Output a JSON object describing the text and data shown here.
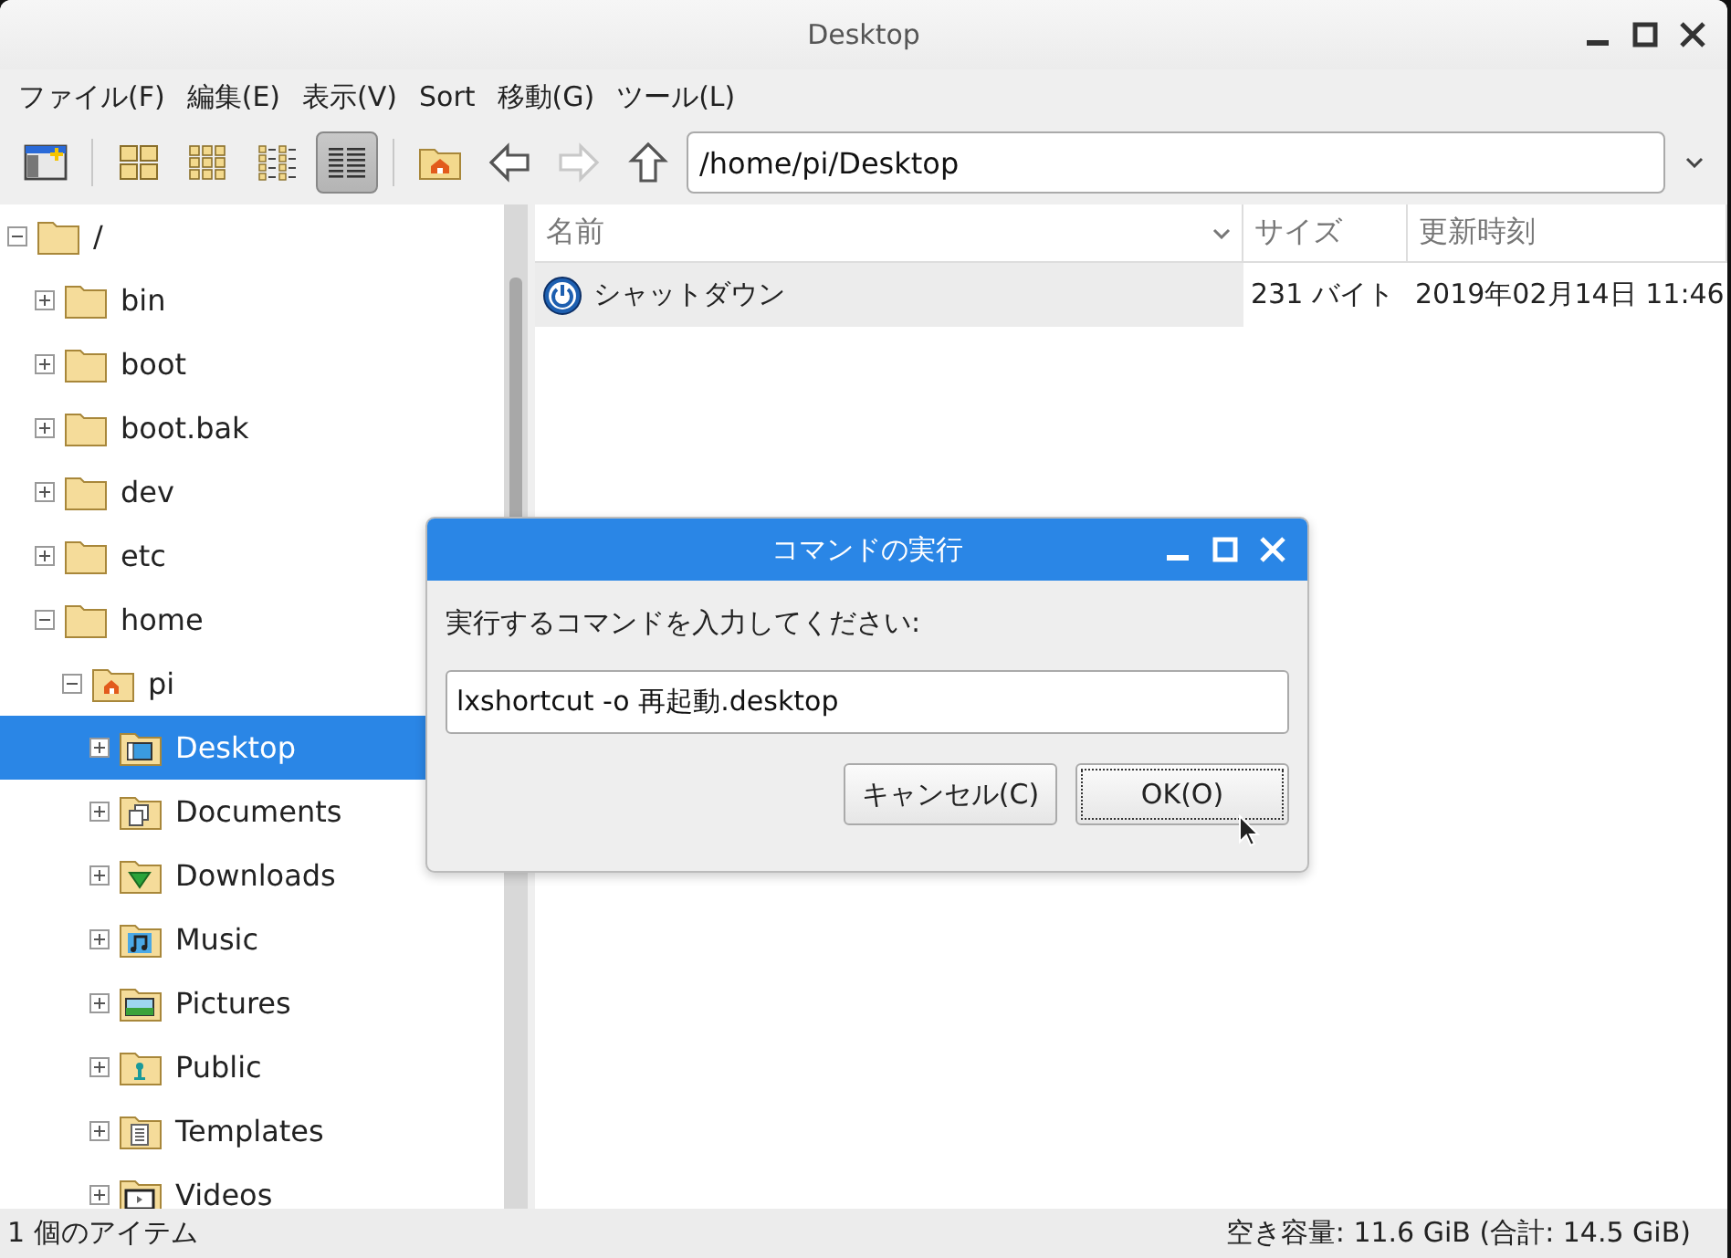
{
  "window": {
    "title": "Desktop"
  },
  "menu": [
    "ファイル(F)",
    "編集(E)",
    "表示(V)",
    "Sort",
    "移動(G)",
    "ツール(L)"
  ],
  "toolbar": {
    "view_modes": [
      {
        "kind": "icons",
        "selected": false
      },
      {
        "kind": "thumbnails",
        "selected": false
      },
      {
        "kind": "compact",
        "selected": false
      },
      {
        "kind": "list",
        "selected": true
      }
    ],
    "nav": [
      {
        "kind": "home",
        "disabled": false
      },
      {
        "kind": "back",
        "disabled": false
      },
      {
        "kind": "forward",
        "disabled": true
      },
      {
        "kind": "up",
        "disabled": false
      }
    ],
    "path": "/home/pi/Desktop"
  },
  "tree": [
    {
      "label": "/",
      "kind": "folder",
      "expanded": true,
      "selected": false,
      "children": [
        {
          "label": "bin",
          "kind": "folder",
          "expanded": false,
          "selected": false
        },
        {
          "label": "boot",
          "kind": "folder",
          "expanded": false,
          "selected": false
        },
        {
          "label": "boot.bak",
          "kind": "folder",
          "expanded": false,
          "selected": false
        },
        {
          "label": "dev",
          "kind": "folder",
          "expanded": false,
          "selected": false
        },
        {
          "label": "etc",
          "kind": "folder",
          "expanded": false,
          "selected": false
        },
        {
          "label": "home",
          "kind": "folder",
          "expanded": true,
          "selected": false,
          "children": [
            {
              "label": "pi",
              "kind": "home",
              "expanded": true,
              "selected": false,
              "children": [
                {
                  "label": "Desktop",
                  "kind": "desktop",
                  "expanded": false,
                  "selected": true
                },
                {
                  "label": "Documents",
                  "kind": "documents",
                  "expanded": false,
                  "selected": false
                },
                {
                  "label": "Downloads",
                  "kind": "downloads",
                  "expanded": false,
                  "selected": false
                },
                {
                  "label": "Music",
                  "kind": "music",
                  "expanded": false,
                  "selected": false
                },
                {
                  "label": "Pictures",
                  "kind": "pictures",
                  "expanded": false,
                  "selected": false
                },
                {
                  "label": "Public",
                  "kind": "public",
                  "expanded": false,
                  "selected": false
                },
                {
                  "label": "Templates",
                  "kind": "templates",
                  "expanded": false,
                  "selected": false
                },
                {
                  "label": "Videos",
                  "kind": "videos",
                  "expanded": false,
                  "selected": false
                }
              ]
            }
          ]
        }
      ]
    }
  ],
  "table": {
    "columns": [
      {
        "label": "名前",
        "sorted": true
      },
      {
        "label": "サイズ",
        "sorted": false
      },
      {
        "label": "更新時刻",
        "sorted": false
      }
    ],
    "rows": [
      {
        "name": "シャットダウン",
        "size": "231 バイト",
        "modified": "2019年02月14日 11:46",
        "hovered": true
      }
    ]
  },
  "dialog": {
    "title": "コマンドの実行",
    "prompt": "実行するコマンドを入力してください:",
    "value": "lxshortcut -o 再起動.desktop",
    "buttons": [
      {
        "label": "キャンセル(C)",
        "default": false
      },
      {
        "label": "OK(O)",
        "default": true
      }
    ]
  },
  "status_bar": {
    "left": "1 個のアイテム",
    "right": "空き容量: 11.6 GiB (合計: 14.5 GiB)"
  }
}
